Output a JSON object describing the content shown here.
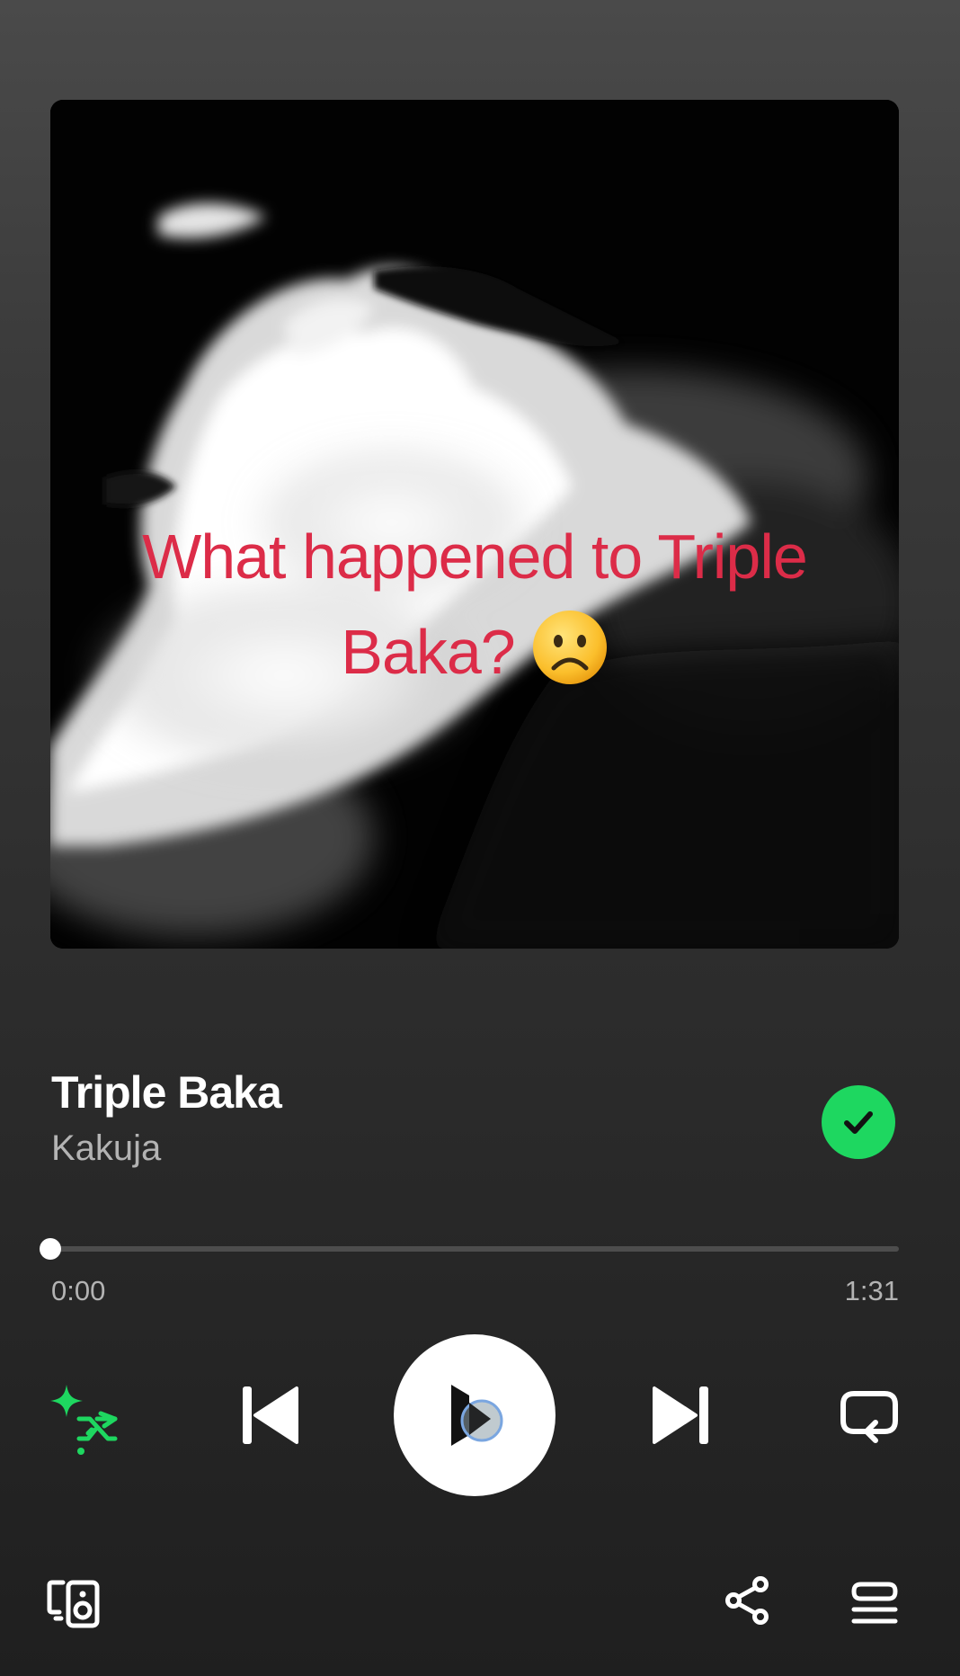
{
  "album_art": {
    "caption_line1": "What happened to Triple",
    "caption_line2": "Baka?",
    "caption_emoji": "frowning-face-emoji",
    "caption_color": "#dc2c48"
  },
  "track": {
    "title": "Triple Baka",
    "artist": "Kakuja",
    "saved_icon": "check-icon",
    "saved_color": "#1ed760"
  },
  "playback": {
    "elapsed": "0:00",
    "duration": "1:31",
    "progress": 0.0
  },
  "controls": {
    "smart_shuffle_icon": "smart-shuffle-icon",
    "previous_icon": "skip-previous-icon",
    "play_icon": "play-icon",
    "next_icon": "skip-next-icon",
    "repeat_icon": "repeat-icon",
    "accent": "#1ed760"
  },
  "footer": {
    "devices_icon": "connect-device-icon",
    "share_icon": "share-icon",
    "queue_icon": "queue-icon"
  }
}
